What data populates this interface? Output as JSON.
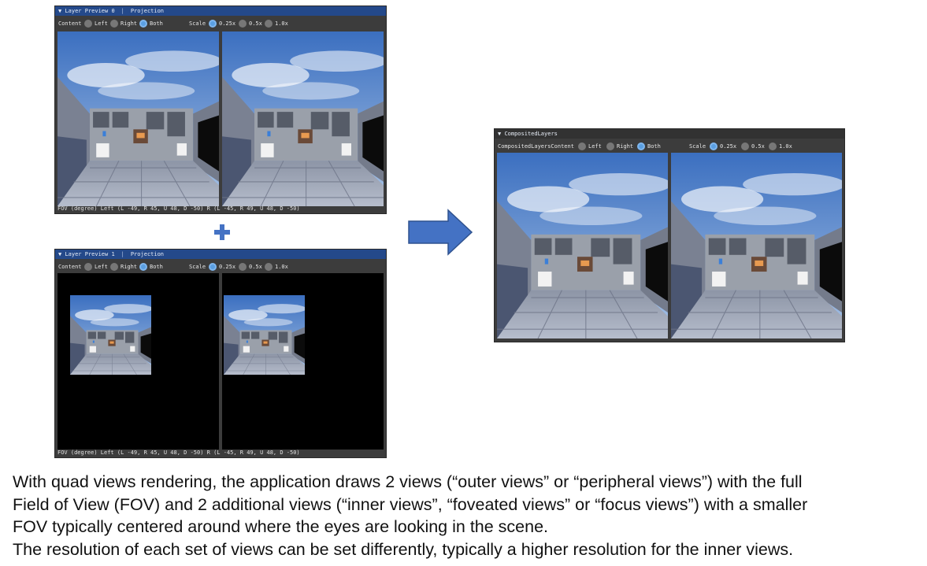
{
  "preview0": {
    "title": "Layer Preview 0",
    "mode": "Projection",
    "content_label": "Content",
    "options": [
      "Left",
      "Right",
      "Both"
    ],
    "selected_content": "Both",
    "scale_label": "Scale",
    "scales": [
      "0.25x",
      "0.5x",
      "1.0x"
    ],
    "selected_scale": "0.25x",
    "status": "FOV (degree)  Left (L -49, R 45, U 48, D -50) R (L -45, R 49, U 48, D -50)"
  },
  "preview1": {
    "title": "Layer Preview 1",
    "mode": "Projection",
    "content_label": "Content",
    "options": [
      "Left",
      "Right",
      "Both"
    ],
    "selected_content": "Both",
    "scale_label": "Scale",
    "scales": [
      "0.25x",
      "0.5x",
      "1.0x"
    ],
    "selected_scale": "0.25x",
    "status": "FOV (degree)  Left (L -49, R 45, U 48, D -50) R (L -45, R 49, U 48, D -50)"
  },
  "composited": {
    "title": "CompositedLayers",
    "content_label": "CompositedLayersContent",
    "options": [
      "Left",
      "Right",
      "Both"
    ],
    "selected_content": "Both",
    "scale_label": "Scale",
    "scales": [
      "0.25x",
      "0.5x",
      "1.0x"
    ],
    "selected_scale": "0.25x"
  },
  "icons": {
    "collapse": "triangle-down-icon",
    "plus": "plus-icon",
    "arrow": "arrow-right-icon"
  },
  "colors": {
    "titlebar": "#24498a",
    "arrow": "#4472c4",
    "radio_selected": "#5a9fe2"
  },
  "caption": [
    "With quad views rendering, the application draws 2 views (“outer views” or “peripheral views”) with the full",
    "Field of View (FOV) and 2 additional views (“inner views”, “foveated views” or “focus views”) with a smaller",
    "FOV typically centered around where the eyes are looking in the scene.",
    "The resolution of each set of views can be set differently, typically a higher resolution for the inner views."
  ]
}
